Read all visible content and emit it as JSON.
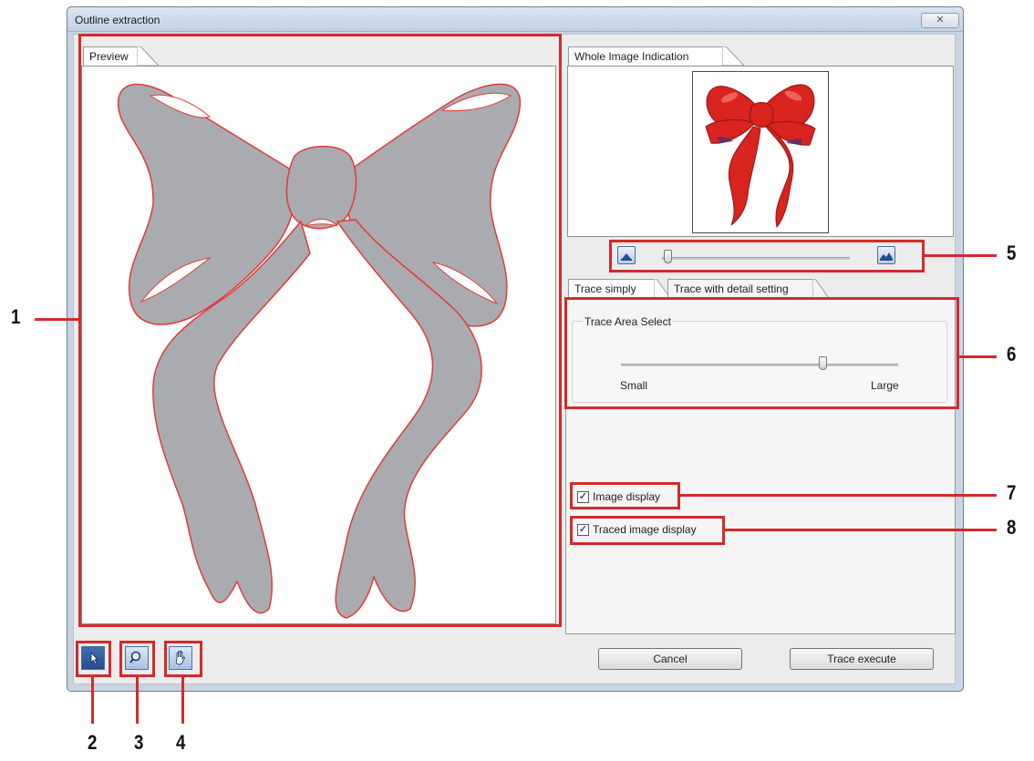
{
  "window": {
    "title": "Outline extraction",
    "close_glyph": "✕"
  },
  "preview": {
    "tab_label": "Preview"
  },
  "whole_image": {
    "tab_label": "Whole Image Indication"
  },
  "zoom_slider": {
    "value_fraction": 0.03,
    "zoom_out_icon": "small-mountain-icon",
    "zoom_in_icon": "large-mountain-icon"
  },
  "trace_tabs": {
    "simple_label": "Trace simply",
    "detail_label": "Trace with detail setting",
    "active": "Trace simply"
  },
  "trace_area": {
    "group_label": "Trace Area Select",
    "min_label": "Small",
    "max_label": "Large",
    "value_fraction": 0.73
  },
  "checkboxes": {
    "image_display": {
      "label": "Image display",
      "checked": true
    },
    "traced_image_display": {
      "label": "Traced image display",
      "checked": true
    }
  },
  "buttons": {
    "cancel": "Cancel",
    "trace_execute": "Trace execute"
  },
  "tools": {
    "select": "arrow-pointer-icon",
    "zoom": "magnifier-icon",
    "pan": "hand-icon",
    "active": "select"
  },
  "callouts": {
    "c1": "1",
    "c2": "2",
    "c3": "3",
    "c4": "4",
    "c5": "5",
    "c6": "6",
    "c7": "7",
    "c8": "8"
  },
  "colors": {
    "highlight": "#d42a2a",
    "ribbon_outline_fill": "#aaabb0",
    "ribbon_outline_stroke": "#e23a3a",
    "ribbon_red": "#d9231f"
  }
}
